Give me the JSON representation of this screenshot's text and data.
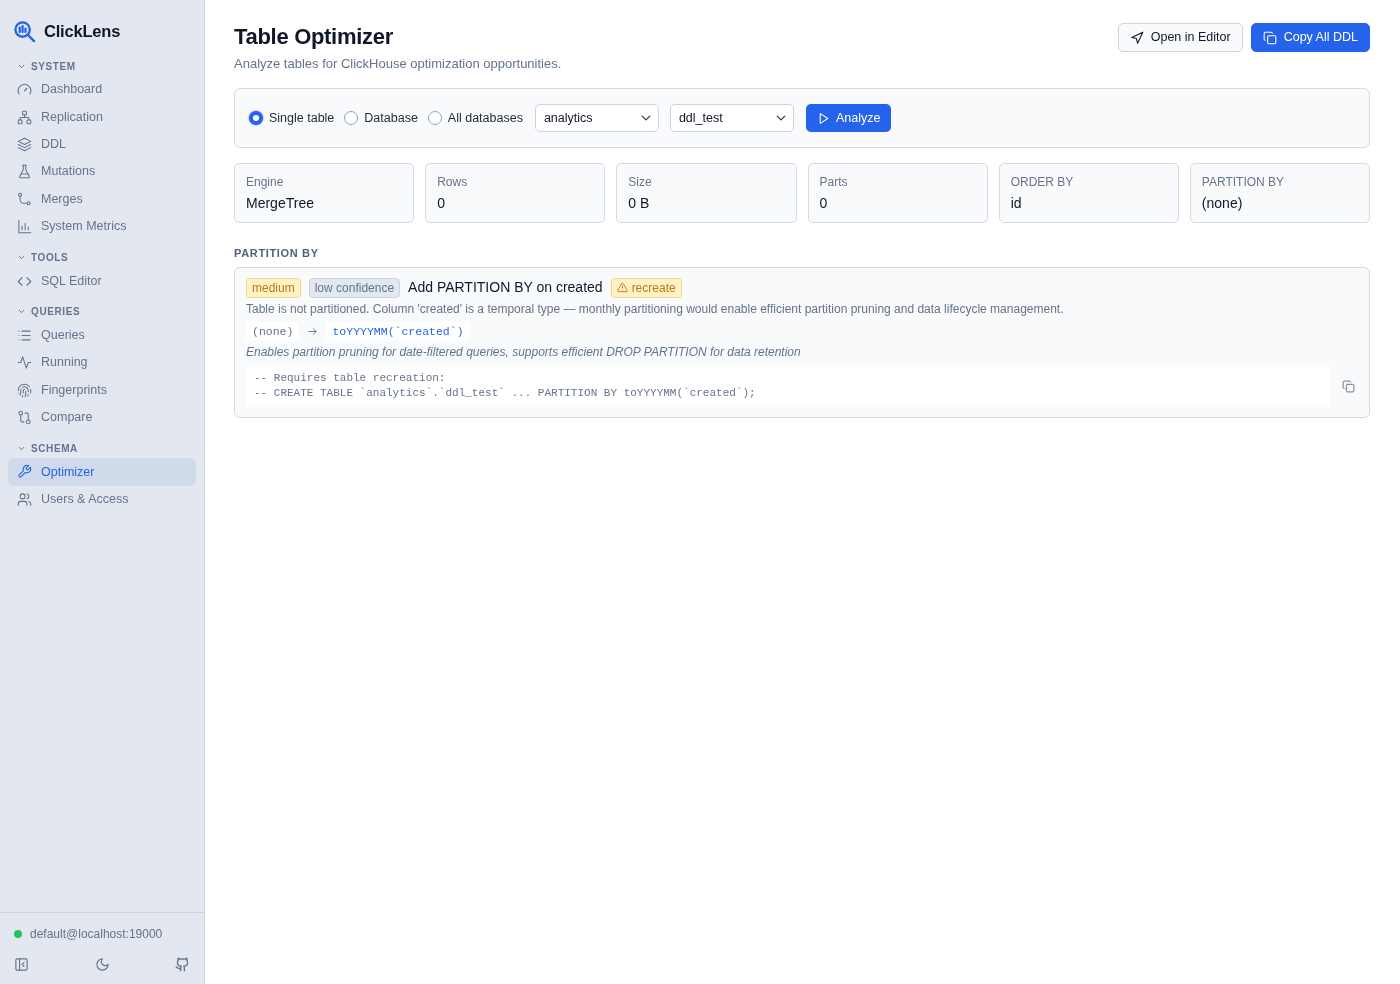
{
  "sidebar": {
    "brand": "ClickLens",
    "sections": [
      {
        "title": "SYSTEM",
        "expanded": true,
        "items": [
          {
            "label": "Dashboard",
            "selected": false
          },
          {
            "label": "Replication",
            "selected": false
          },
          {
            "label": "DDL",
            "selected": false
          },
          {
            "label": "Mutations",
            "selected": false
          },
          {
            "label": "Merges",
            "selected": false
          },
          {
            "label": "System Metrics",
            "selected": false
          }
        ]
      },
      {
        "title": "TOOLS",
        "expanded": true,
        "items": [
          {
            "label": "SQL Editor",
            "selected": false
          }
        ]
      },
      {
        "title": "QUERIES",
        "expanded": true,
        "items": [
          {
            "label": "Queries",
            "selected": false
          },
          {
            "label": "Running",
            "selected": false
          },
          {
            "label": "Fingerprints",
            "selected": false
          },
          {
            "label": "Compare",
            "selected": false
          }
        ]
      },
      {
        "title": "SCHEMA",
        "expanded": true,
        "items": [
          {
            "label": "Optimizer",
            "selected": true
          },
          {
            "label": "Users & Access",
            "selected": false
          }
        ]
      }
    ],
    "connection": {
      "label": "default@localhost:19000",
      "connected": true
    }
  },
  "header": {
    "title": "Table Optimizer",
    "subtitle": "Analyze tables for ClickHouse optimization opportunities.",
    "actions": [
      {
        "label": "Open in Editor",
        "kind": "secondary"
      },
      {
        "label": "Copy All DDL",
        "kind": "primary"
      }
    ]
  },
  "scope": {
    "options": [
      {
        "label": "Single table",
        "selected": true
      },
      {
        "label": "Database",
        "selected": false
      },
      {
        "label": "All databases",
        "selected": false
      }
    ],
    "database": "analytics",
    "table": "ddl_test",
    "button": "Analyze"
  },
  "stats": [
    {
      "label": "Engine",
      "value": "MergeTree"
    },
    {
      "label": "Rows",
      "value": "0"
    },
    {
      "label": "Size",
      "value": "0 B"
    },
    {
      "label": "Parts",
      "value": "0"
    },
    {
      "label": "ORDER BY",
      "value": "id"
    },
    {
      "label": "PARTITION BY",
      "value": "(none)"
    }
  ],
  "groups": [
    {
      "title": "PARTITION BY",
      "recommendations": [
        {
          "badges": [
            {
              "text": "medium",
              "kind": "warning"
            },
            {
              "text": "low confidence",
              "kind": "muted"
            }
          ],
          "title": "Add PARTITION BY on created",
          "flags": [
            {
              "text": "recreate",
              "kind": "warning"
            }
          ],
          "description": "Table is not partitioned. Column 'created' is a temporal type — monthly partitioning would enable efficient partition pruning and data lifecycle management.",
          "current": "(none)",
          "proposed": "toYYYYMM(`created`)",
          "benefit": "Enables partition pruning for date-filtered queries, supports efficient DROP PARTITION for data retention",
          "ddl": "-- Requires table recreation:\n-- CREATE TABLE `analytics`.`ddl_test` ... PARTITION BY toYYYYMM(`created`);"
        }
      ]
    }
  ]
}
